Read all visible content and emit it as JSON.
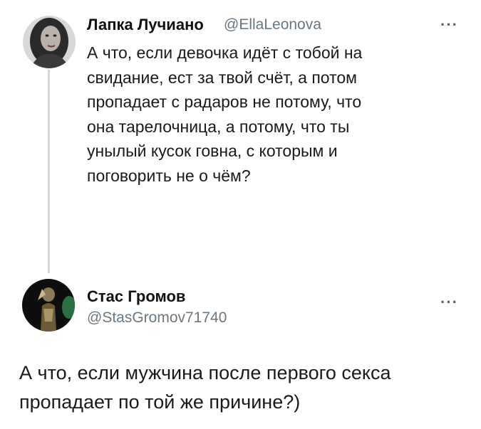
{
  "tweet1": {
    "author": "Лапка Лучиано",
    "handle": "@EllaLeonova",
    "more_icon": "more-horizontal-icon",
    "avatar_icon": "avatar-photo-woman",
    "text": "А что, если девочка идёт с тобой на\nсвидание, ест за твой счёт, а потом\nпропадает с радаров не потому, что\nона тарелочница, а потому, что ты\nунылый кусок говна, с которым и\nпоговорить не о чём?"
  },
  "tweet2": {
    "author": "Стас Громов",
    "handle": "@StasGromov71740",
    "more_icon": "more-horizontal-icon",
    "avatar_icon": "avatar-photo-figure",
    "text": "А что, если мужчина после первого секса\nпропадает по той же причине?)"
  },
  "colors": {
    "text": "#111111",
    "handle": "#6b7780",
    "thread_line": "#cfd9de"
  }
}
